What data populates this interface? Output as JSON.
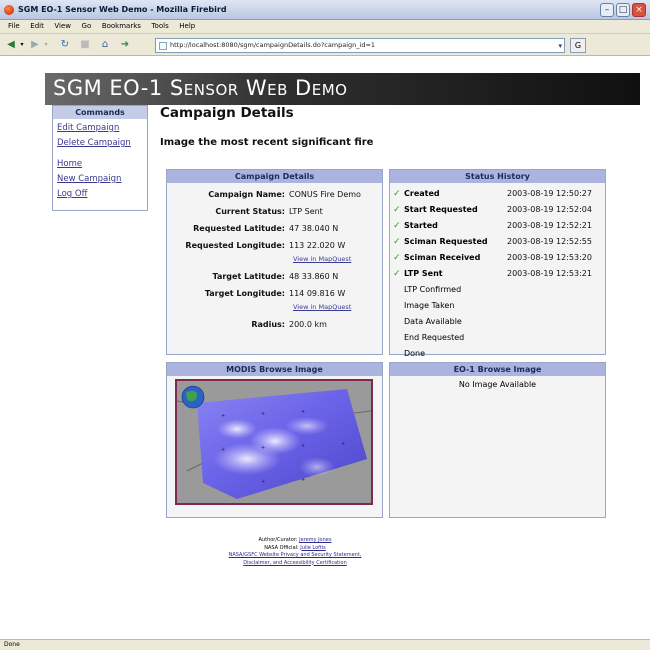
{
  "window": {
    "title": "SGM EO-1 Sensor Web Demo - Mozilla Firebird",
    "menu": [
      "File",
      "Edit",
      "View",
      "Go",
      "Bookmarks",
      "Tools",
      "Help"
    ],
    "url": "http://localhost:8080/sgm/campaignDetails.do?campaign_id=1",
    "status": "Done"
  },
  "banner": {
    "title": "SGM EO-1 Sensor Web Demo"
  },
  "sidebar": {
    "heading": "Commands",
    "items": [
      "Edit Campaign",
      "Delete Campaign",
      "Home",
      "New Campaign",
      "Log Off"
    ]
  },
  "page": {
    "title": "Campaign Details",
    "subtitle": "Image the most recent significant fire"
  },
  "details": {
    "heading": "Campaign Details",
    "rows": [
      {
        "label": "Campaign Name:",
        "value": "CONUS Fire Demo"
      },
      {
        "label": "Current Status:",
        "value": "LTP Sent"
      },
      {
        "label": "Requested Latitude:",
        "value": "47 38.040 N"
      },
      {
        "label": "Requested Longitude:",
        "value": "113 22.020 W"
      },
      {
        "label": "Target Latitude:",
        "value": "48 33.860 N"
      },
      {
        "label": "Target Longitude:",
        "value": "114 09.816 W"
      },
      {
        "label": "Radius:",
        "value": "200.0 km"
      }
    ],
    "map_link_1": "View in MapQuest",
    "map_link_2": "View in MapQuest"
  },
  "history": {
    "heading": "Status History",
    "items": [
      {
        "name": "Created",
        "time": "2003-08-19 12:50:27",
        "check": "✓"
      },
      {
        "name": "Start Requested",
        "time": "2003-08-19 12:52:04",
        "check": "✓"
      },
      {
        "name": "Started",
        "time": "2003-08-19 12:52:21",
        "check": "✓"
      },
      {
        "name": "Sciman Requested",
        "time": "2003-08-19 12:52:55",
        "check": "✓"
      },
      {
        "name": "Sciman Received",
        "time": "2003-08-19 12:53:20",
        "check": "✓"
      },
      {
        "name": "LTP Sent",
        "time": "2003-08-19 12:53:21",
        "check": "✓"
      },
      {
        "name": "LTP Confirmed",
        "time": "",
        "check": ""
      },
      {
        "name": "Image Taken",
        "time": "",
        "check": ""
      },
      {
        "name": "Data Available",
        "time": "",
        "check": ""
      },
      {
        "name": "End Requested",
        "time": "",
        "check": ""
      },
      {
        "name": "Done",
        "time": "",
        "check": ""
      }
    ]
  },
  "modis": {
    "heading": "MODIS Browse Image"
  },
  "eo1": {
    "heading": "EO-1 Browse Image",
    "message": "No Image Available"
  },
  "footer": {
    "author_label": "Author/Curator:",
    "author_name": "Jeremy Jones",
    "official_label": "NASA Official:",
    "official_name": "Julie Loftis",
    "privacy": "NASA/GSFC Website Privacy and Security Statement,",
    "disclaimer": "Disclaimer, and Accessibility Certification"
  },
  "colors": {
    "panel_header": "#aab4de",
    "link": "#3a3a8f",
    "check": "#2e9a22",
    "banner": "#1a1a1a"
  }
}
